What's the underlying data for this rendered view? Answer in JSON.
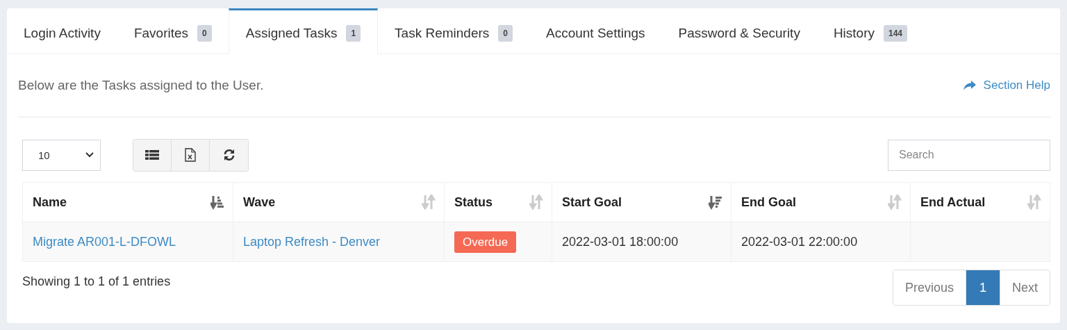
{
  "tabs": [
    {
      "label": "Login Activity",
      "selected": false
    },
    {
      "label": "Favorites",
      "badge": "0",
      "selected": false
    },
    {
      "label": "Assigned Tasks",
      "badge": "1",
      "selected": true
    },
    {
      "label": "Task Reminders",
      "badge": "0",
      "selected": false
    },
    {
      "label": "Account Settings",
      "selected": false
    },
    {
      "label": "Password & Security",
      "selected": false
    },
    {
      "label": "History",
      "badge": "144",
      "selected": false
    }
  ],
  "description": "Below are the Tasks assigned to the User.",
  "help_link": "Section Help",
  "page_length": "10",
  "search": {
    "placeholder": "Search"
  },
  "table": {
    "columns": [
      {
        "label": "Name",
        "sorted_ascending": true,
        "sorted_descending": false
      },
      {
        "label": "Wave",
        "sorted_ascending": false,
        "sorted_descending": false
      },
      {
        "label": "Status",
        "sorted_ascending": false,
        "sorted_descending": false
      },
      {
        "label": "Start Goal",
        "sorted_ascending": false,
        "sorted_descending": true
      },
      {
        "label": "End Goal",
        "sorted_ascending": false,
        "sorted_descending": false
      },
      {
        "label": "End Actual",
        "sorted_ascending": false,
        "sorted_descending": false
      }
    ],
    "rows": [
      {
        "name": "Migrate AR001-L-DFOWL",
        "wave": "Laptop Refresh - Denver",
        "status": "Overdue",
        "start_goal": "2022-03-01 18:00:00",
        "end_goal": "2022-03-01 22:00:00"
      }
    ]
  },
  "info": "Showing 1 to 1 of 1 entries",
  "pagination": [
    {
      "label": "Previous",
      "selected": false
    },
    {
      "label": "1",
      "selected": true
    },
    {
      "label": "Next",
      "selected": false
    }
  ]
}
